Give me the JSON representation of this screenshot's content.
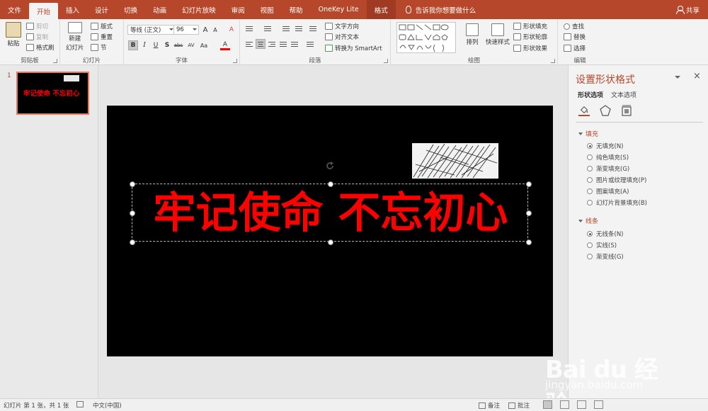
{
  "tabs": [
    "文件",
    "开始",
    "插入",
    "设计",
    "切换",
    "动画",
    "幻灯片放映",
    "审阅",
    "视图",
    "帮助",
    "OneKey Lite",
    "格式"
  ],
  "active_tab": "开始",
  "tell_me": "告诉我你想要做什么",
  "share": "共享",
  "clipboard": {
    "paste": "粘贴",
    "cut": "剪切",
    "copy": "复制",
    "format_painter": "格式刷",
    "label": "剪贴板"
  },
  "slides_group": {
    "new_slide_line1": "新建",
    "new_slide_line2": "幻灯片",
    "layout": "版式",
    "reset": "重置",
    "section": "节",
    "label": "幻灯片"
  },
  "font_group": {
    "font_name": "等线 (正文)",
    "font_size": "96",
    "grow": "A",
    "shrink": "A",
    "clear": "A",
    "bold": "B",
    "italic": "I",
    "underline": "U",
    "shadow": "S",
    "strike": "abc",
    "spacing": "AV",
    "case": "Aa",
    "color": "A",
    "label": "字体"
  },
  "paragraph_group": {
    "text_direction": "文字方向",
    "align_text": "对齐文本",
    "smartart": "转换为 SmartArt",
    "label": "段落"
  },
  "drawing_group": {
    "arrange": "排列",
    "quick_styles": "快速样式",
    "shape_fill": "形状填充",
    "shape_outline": "形状轮廓",
    "shape_effects": "形状效果",
    "label": "绘图"
  },
  "editing_group": {
    "find": "查找",
    "replace": "替换",
    "select": "选择",
    "label": "编辑"
  },
  "thumbnail": {
    "number": "1",
    "text": "牢记使命 不忘初心"
  },
  "slide": {
    "title": "牢记使命 不忘初心"
  },
  "format_panel": {
    "title": "设置形状格式",
    "close": "×",
    "tab_shape": "形状选项",
    "tab_text": "文本选项",
    "fill_section": "填充",
    "fill_options": [
      "无填充(N)",
      "纯色填充(S)",
      "渐变填充(G)",
      "图片或纹理填充(P)",
      "图案填充(A)",
      "幻灯片背景填充(B)"
    ],
    "line_section": "线条",
    "line_options": [
      "无线条(N)",
      "实线(S)",
      "渐变线(G)"
    ]
  },
  "status": {
    "slide_info": "幻灯片 第 1 张，共 1 张",
    "language": "中文(中国)",
    "notes": "备注",
    "comments": "批注"
  },
  "watermark": {
    "main": "Bai du 经验",
    "sub": "jingyan.baidu.com"
  },
  "colors": {
    "accent": "#b7472a",
    "title_text": "#ff0000",
    "slide_bg": "#000000"
  }
}
